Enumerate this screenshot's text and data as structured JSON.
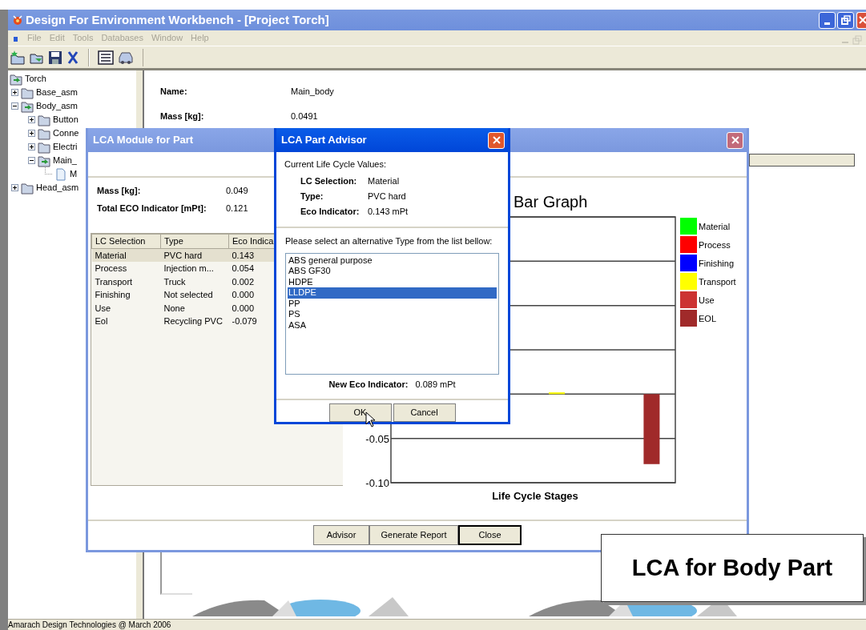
{
  "window": {
    "title": "Design For Environment Workbench - [Project Torch]"
  },
  "menu": [
    {
      "label": "File",
      "disabled": true
    },
    {
      "label": "Edit",
      "disabled": true
    },
    {
      "label": "Tools",
      "disabled": true
    },
    {
      "label": "Databases",
      "disabled": true
    },
    {
      "label": "Window",
      "disabled": true
    },
    {
      "label": "Help",
      "disabled": true
    }
  ],
  "tree": [
    {
      "label": "Torch",
      "kind": "assembly",
      "children": [
        {
          "label": "Base_asm",
          "kind": "folder",
          "expanded": false
        },
        {
          "label": "Body_asm",
          "kind": "assembly",
          "expanded": true,
          "children": [
            {
              "label": "Button",
              "kind": "folder",
              "expanded": false
            },
            {
              "label": "Conne",
              "kind": "folder",
              "expanded": false
            },
            {
              "label": "Electri",
              "kind": "folder",
              "expanded": false
            },
            {
              "label": "Main_",
              "kind": "assembly",
              "expanded": true,
              "children": [
                {
                  "label": "M",
                  "kind": "part"
                }
              ]
            }
          ]
        },
        {
          "label": "Head_asm",
          "kind": "folder",
          "expanded": false
        }
      ]
    }
  ],
  "details": [
    {
      "label": "Name:",
      "value": "Main_body"
    },
    {
      "label": "Mass [kg]:",
      "value": "0.0491"
    }
  ],
  "module_dialog": {
    "title": "LCA Module for Part",
    "active": false,
    "summary": [
      {
        "label": "Mass [kg]:",
        "value": "0.049"
      },
      {
        "label": "Total ECO Indicator [mPt]:",
        "value": "0.121"
      }
    ],
    "table": {
      "columns": [
        "LC Selection",
        "Type",
        "Eco Indica"
      ],
      "rows": [
        {
          "cells": [
            "Material",
            "PVC hard",
            "0.143"
          ],
          "selected": true
        },
        {
          "cells": [
            "Process",
            "Injection m...",
            "0.054"
          ],
          "selected": false
        },
        {
          "cells": [
            "Transport",
            "Truck",
            "0.002"
          ],
          "selected": false
        },
        {
          "cells": [
            "Finishing",
            "Not selected",
            "0.000"
          ],
          "selected": false
        },
        {
          "cells": [
            "Use",
            "None",
            "0.000"
          ],
          "selected": false
        },
        {
          "cells": [
            "Eol",
            "Recycling PVC",
            "-0.079"
          ],
          "selected": false
        }
      ]
    },
    "chart_data": {
      "type": "bar",
      "title": "Bar Graph",
      "xlabel": "Life Cycle Stages",
      "legend": "right",
      "ylim": [
        -0.1,
        0.2
      ],
      "yticks": [
        {
          "value": -0.05,
          "label": "-0.05"
        },
        {
          "value": -0.1,
          "label": "-0.10"
        }
      ],
      "series": [
        {
          "name": "Material",
          "color": "#00ff00",
          "values": [
            null,
            null,
            null,
            null,
            null,
            null
          ]
        },
        {
          "name": "Process",
          "color": "#ff0000",
          "values": [
            null,
            null,
            null,
            null,
            null,
            null
          ]
        },
        {
          "name": "Finishing",
          "color": "#0000ff",
          "values": [
            null,
            null,
            0.0,
            null,
            null,
            null
          ]
        },
        {
          "name": "Transport",
          "color": "#ffff00",
          "values": [
            null,
            null,
            null,
            0.002,
            null,
            null
          ]
        },
        {
          "name": "Use",
          "color": "#cc3333",
          "values": [
            null,
            null,
            null,
            null,
            0.0,
            null
          ]
        },
        {
          "name": "EOL",
          "color": "#a02a2a",
          "values": [
            null,
            null,
            null,
            null,
            null,
            -0.079
          ]
        }
      ]
    },
    "buttons": [
      {
        "label": "Advisor",
        "default": false
      },
      {
        "label": "Generate Report",
        "default": false
      },
      {
        "label": "Close",
        "default": true
      }
    ]
  },
  "advisor_dialog": {
    "title": "LCA Part Advisor",
    "active": true,
    "heading": "Current Life Cycle Values:",
    "values": [
      {
        "label": "LC Selection:",
        "value": "Material"
      },
      {
        "label": "Type:",
        "value": "PVC hard"
      },
      {
        "label": "Eco Indicator:",
        "value": "0.143 mPt"
      }
    ],
    "prompt": "Please select an alternative Type from the list bellow:",
    "options": [
      {
        "label": "ABS general purpose",
        "selected": false
      },
      {
        "label": "ABS GF30",
        "selected": false
      },
      {
        "label": "HDPE",
        "selected": false
      },
      {
        "label": "LLDPE",
        "selected": true
      },
      {
        "label": "PP",
        "selected": false
      },
      {
        "label": "PS",
        "selected": false
      },
      {
        "label": "ASA",
        "selected": false
      }
    ],
    "result": {
      "label": "New Eco Indicator:",
      "value": "0.089 mPt"
    },
    "buttons": [
      {
        "label": "OK"
      },
      {
        "label": "Cancel"
      }
    ]
  },
  "callout": {
    "text": "LCA for Body Part"
  },
  "status_bar": {
    "text": "Amarach Design Technologies @ March 2006"
  }
}
